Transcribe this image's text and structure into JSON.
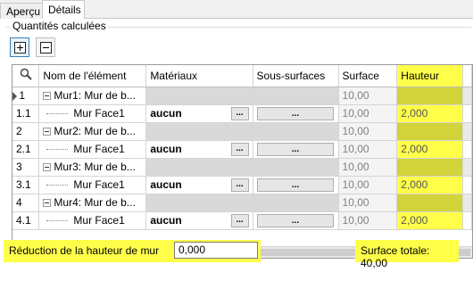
{
  "tabs": [
    {
      "label": "Aperçu"
    },
    {
      "label": "Détails"
    }
  ],
  "group_title": "Quantités calculées",
  "columns": {
    "name": "Nom de l'élément",
    "materials": "Matériaux",
    "subsurfaces": "Sous-surfaces",
    "surface": "Surface",
    "hauteur": "Hauteur"
  },
  "rows": [
    {
      "index": "1",
      "name": "Mur1: Mur de b...",
      "surface": "10,00"
    },
    {
      "index": "1.1",
      "name": "Mur Face1",
      "material": "aucun",
      "btn": "...",
      "sub_btn": "...",
      "surface": "10,00",
      "hauteur": "2,000"
    },
    {
      "index": "2",
      "name": "Mur2: Mur de b...",
      "surface": "10,00"
    },
    {
      "index": "2.1",
      "name": "Mur Face1",
      "material": "aucun",
      "btn": "...",
      "sub_btn": "...",
      "surface": "10,00",
      "hauteur": "2,000"
    },
    {
      "index": "3",
      "name": "Mur3: Mur de b...",
      "surface": "10,00"
    },
    {
      "index": "3.1",
      "name": "Mur Face1",
      "material": "aucun",
      "btn": "...",
      "sub_btn": "...",
      "surface": "10,00",
      "hauteur": "2,000"
    },
    {
      "index": "4",
      "name": "Mur4: Mur de b...",
      "surface": "10,00"
    },
    {
      "index": "4.1",
      "name": "Mur Face1",
      "material": "aucun",
      "btn": "...",
      "sub_btn": "...",
      "surface": "10,00",
      "hauteur": "2,000"
    }
  ],
  "footer": {
    "reduction_label": "Réduction de la hauteur de mur",
    "reduction_value": "0,000",
    "total": "Surface totale: 40,00"
  },
  "colors": {
    "highlight": "#ffff4a",
    "highlight_dark": "#d3d33c",
    "accent": "#3c7fb1"
  },
  "icons": {
    "expand": "expand-all-icon",
    "collapse": "collapse-all-icon",
    "search": "search-icon",
    "row_pointer": "row-pointer-icon",
    "tree_collapse": "tree-collapse-icon"
  }
}
